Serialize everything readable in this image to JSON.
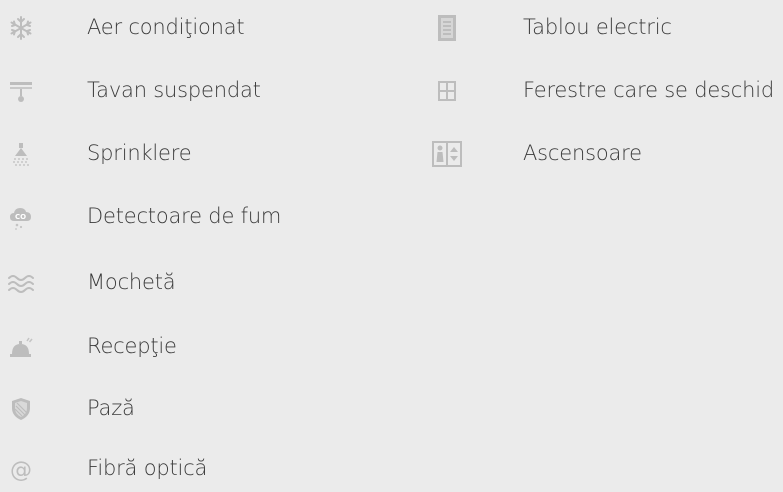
{
  "amenities_left": [
    {
      "label": "Aer condiţionat",
      "icon": "snowflake-icon"
    },
    {
      "label": "Tavan suspendat",
      "icon": "ceiling-lamp-icon"
    },
    {
      "label": "Sprinklere",
      "icon": "sprinkler-icon"
    },
    {
      "label": "Detectoare de fum",
      "icon": "smoke-detector-icon"
    },
    {
      "label": "Mochetă",
      "icon": "carpet-waves-icon"
    },
    {
      "label": "Recepţie",
      "icon": "reception-bell-icon"
    },
    {
      "label": "Pază",
      "icon": "security-shield-icon"
    },
    {
      "label": "Fibră optică",
      "icon": "at-sign-icon"
    }
  ],
  "amenities_right": [
    {
      "label": "Tablou electric",
      "icon": "electrical-panel-icon"
    },
    {
      "label": "Ferestre care se deschid",
      "icon": "window-icon"
    },
    {
      "label": "Ascensoare",
      "icon": "elevator-icon"
    }
  ],
  "colors": {
    "background": "#ebebeb",
    "text": "#3b3b3b",
    "icon": "#b8b8b8"
  }
}
